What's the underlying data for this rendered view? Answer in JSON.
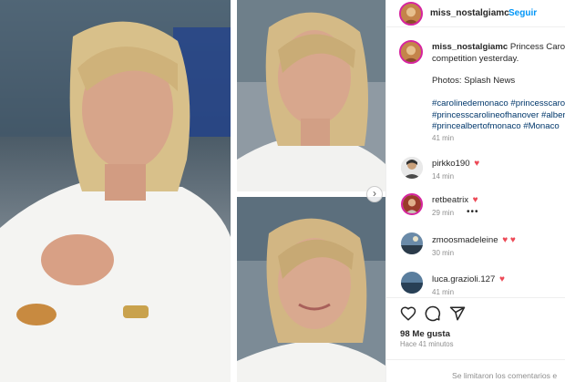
{
  "header": {
    "username": "miss_nostalgiamc",
    "separator": "•",
    "follow_label": "Seguir"
  },
  "caption": {
    "username": "miss_nostalgiamc",
    "text_line1": "Princess Caroline",
    "text_line2": "competition yesterday.",
    "photos_credit": "Photos: Splash News",
    "hashtags": [
      "#carolinedemonaco #princesscarolin",
      "#princesscarolineofhanover #alberto",
      "#princealbertofmonaco #Monaco"
    ],
    "time": "41 min"
  },
  "comments": [
    {
      "username": "pirkko190",
      "hearts": "♥",
      "time": "14 min"
    },
    {
      "username": "retbeatrix",
      "hearts": "♥",
      "time": "29 min",
      "more": "•••"
    },
    {
      "username": "zmoosmadeleine",
      "hearts": "♥ ♥",
      "time": "30 min"
    },
    {
      "username": "luca.grazioli.127",
      "hearts": "♥",
      "time": "41 min"
    }
  ],
  "actions": {
    "like_icon": "heart-icon",
    "comment_icon": "comment-icon",
    "share_icon": "share-icon"
  },
  "likes_text": "98 Me gusta",
  "posted_text": "Hace 41 minutos",
  "comments_limited_text": "Se limitaron los comentarios e",
  "carousel_next": "›",
  "colors": {
    "link_blue": "#0095f6",
    "hashtag_blue": "#00376b",
    "heart_red": "#ed4956",
    "muted_gray": "#8e8e8e"
  }
}
